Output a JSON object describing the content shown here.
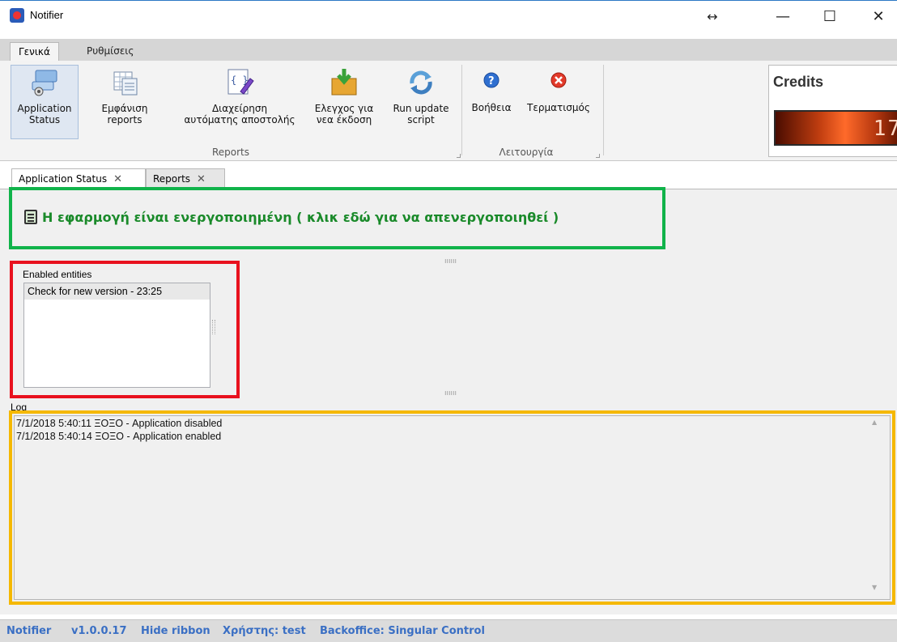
{
  "window": {
    "title": "Notifier",
    "resize_glyph": "↔",
    "minimize_glyph": "—",
    "maximize_glyph": "☐",
    "close_glyph": "✕"
  },
  "ribbon": {
    "tabs": [
      {
        "label": "Γενικά",
        "active": true
      },
      {
        "label": "Ρυθμίσεις",
        "active": false
      }
    ],
    "buttons": [
      {
        "label_line1": "Application",
        "label_line2": "Status",
        "icon": "app-status-icon",
        "selected": true
      },
      {
        "label_line1": "Εμφάνιση",
        "label_line2": "reports",
        "icon": "reports-icon"
      },
      {
        "label_line1": "Διαχείρηση",
        "label_line2": "αυτόματης αποστολής",
        "icon": "script-edit-icon"
      },
      {
        "label_line1": "Ελεγχος για",
        "label_line2": "νεα έκδοση",
        "icon": "download-box-icon"
      },
      {
        "label_line1": "Run update",
        "label_line2": "script",
        "icon": "refresh-icon"
      },
      {
        "label_line1": "Βοήθεια",
        "label_line2": "",
        "icon": "help-icon"
      },
      {
        "label_line1": "Τερματισμός",
        "label_line2": "",
        "icon": "exit-icon"
      }
    ],
    "groups": [
      {
        "label": "Reports"
      },
      {
        "label": "Λειτουργία"
      }
    ]
  },
  "credits": {
    "title": "Credits",
    "value": "17"
  },
  "doc_tabs": [
    {
      "label": "Application Status",
      "close": "✕"
    },
    {
      "label": "Reports",
      "close": "✕"
    }
  ],
  "status": {
    "message": "Η εφαρμογή είναι ενεργοποιημένη ( κλικ εδώ για να απενεργοποιηθεί )"
  },
  "splitter": {
    "dots": "ıııııı"
  },
  "entities": {
    "label": "Enabled entities",
    "items": [
      "Check for new version - 23:25"
    ]
  },
  "log": {
    "label": "Log",
    "lines": [
      "7/1/2018 5:40:11 ΞΟΞΟ - Application disabled",
      "7/1/2018 5:40:14 ΞΟΞΟ - Application enabled"
    ]
  },
  "statusbar": {
    "app": "Notifier",
    "version": "v1.0.0.17",
    "hide_ribbon": "Hide ribbon",
    "user": "Χρήστης: test",
    "backoffice": "Backoffice: Singular Control"
  },
  "colors": {
    "green_highlight": "#10b34a",
    "red_highlight": "#e8111e",
    "yellow_highlight": "#f5b800",
    "status_link": "#1a8a2a",
    "statusbar_text": "#3a6fc4"
  }
}
